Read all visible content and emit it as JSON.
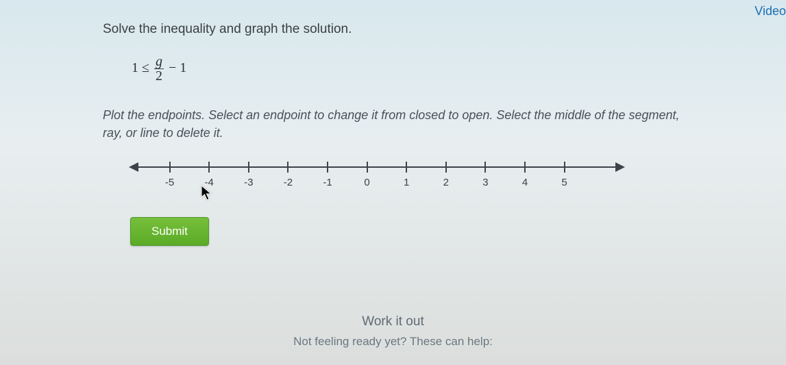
{
  "links": {
    "video": "Video"
  },
  "question": {
    "prompt": "Solve the inequality and graph the solution.",
    "inequality": {
      "lhs": "1",
      "op": "≤",
      "numerator": "g",
      "denominator": "2",
      "tail": " − 1"
    },
    "instructions": "Plot the endpoints. Select an endpoint to change it from closed to open. Select the middle of the segment, ray, or line to delete it."
  },
  "numberline": {
    "ticks": [
      {
        "label": "-5",
        "pos": 8
      },
      {
        "label": "-4",
        "pos": 16
      },
      {
        "label": "-3",
        "pos": 24
      },
      {
        "label": "-2",
        "pos": 32
      },
      {
        "label": "-1",
        "pos": 40
      },
      {
        "label": "0",
        "pos": 48
      },
      {
        "label": "1",
        "pos": 56
      },
      {
        "label": "2",
        "pos": 64
      },
      {
        "label": "3",
        "pos": 72
      },
      {
        "label": "4",
        "pos": 80
      },
      {
        "label": "5",
        "pos": 88
      }
    ]
  },
  "buttons": {
    "submit": "Submit"
  },
  "footer": {
    "work_it_out": "Work it out",
    "not_ready": "Not feeling ready yet? These can help:"
  }
}
